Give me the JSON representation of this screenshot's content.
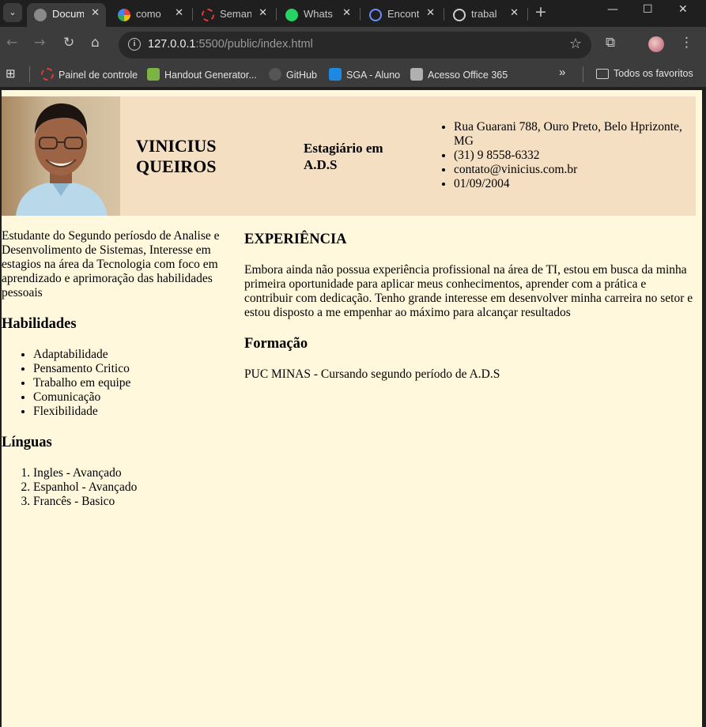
{
  "browser": {
    "tabs": [
      {
        "title": "Docum",
        "active": true,
        "favicon_color": "#8a8a8a"
      },
      {
        "title": "como",
        "active": false,
        "favicon_color": "#4285f4"
      },
      {
        "title": "Seman",
        "active": false,
        "favicon_color": "#e53935"
      },
      {
        "title": "Whats",
        "active": false,
        "favicon_color": "#25d366"
      },
      {
        "title": "Encont",
        "active": false,
        "favicon_color": "#3b5bdb"
      },
      {
        "title": "trabal",
        "active": false,
        "favicon_color": "#cfcfcf"
      }
    ],
    "url_host": "127.0.0.1",
    "url_rest": ":5500/public/index.html",
    "bookmarks": [
      {
        "label": "Painel de controle",
        "color": "#e53935"
      },
      {
        "label": "Handout Generator...",
        "color": "#7cb342"
      },
      {
        "label": "GitHub",
        "color": "#555555"
      },
      {
        "label": "SGA - Aluno",
        "color": "#1e88e5"
      },
      {
        "label": "Acesso Office 365",
        "color": "#b0b0b0"
      }
    ],
    "all_bookmarks_label": "Todos os favoritos"
  },
  "profile": {
    "name": "VINICIUS QUEIROS",
    "role": "Estagiário em A.D.S",
    "contacts": [
      "Rua Guarani 788, Ouro Preto, Belo Hprizonte, MG",
      "(31) 9 8558-6332",
      "contato@vinicius.com.br",
      "01/09/2004"
    ]
  },
  "about": "Estudante do Segundo períosdo de Analise e Desenvolimento de Sistemas, Interesse em estagios na área da Tecnologia com foco em aprendizado e aprimoração das habilidades pessoais",
  "skills": {
    "heading": "Habilidades",
    "items": [
      "Adaptabilidade",
      "Pensamento Critico",
      "Trabalho em equipe",
      "Comunicação",
      "Flexibilidade"
    ]
  },
  "languages": {
    "heading": "Línguas",
    "items": [
      "Ingles - Avançado",
      "Espanhol - Avançado",
      "Francês - Basico"
    ]
  },
  "experience": {
    "heading": "EXPERIÊNCIA",
    "text": "Embora ainda não possua experiência profissional na área de TI, estou em busca da minha primeira oportunidade para aplicar meus conhecimentos, aprender com a prática e contribuir com dedicação. Tenho grande interesse em desenvolver minha carreira no setor e estou disposto a me empenhar ao máximo para alcançar resultados"
  },
  "education": {
    "heading": "Formação",
    "text": "PUC MINAS - Cursando segundo período de A.D.S"
  }
}
